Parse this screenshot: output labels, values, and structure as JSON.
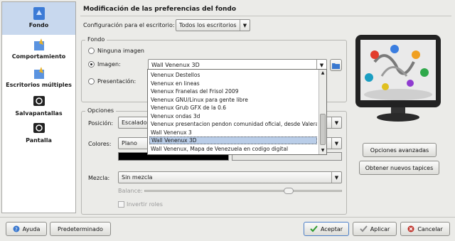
{
  "sidebar": {
    "items": [
      {
        "label": "Fondo",
        "icon": "background-icon",
        "active": true
      },
      {
        "label": "Comportamiento",
        "icon": "behavior-icon",
        "active": false
      },
      {
        "label": "Escritorios múltiples",
        "icon": "multiple-desktops-icon",
        "active": false
      },
      {
        "label": "Salvapantallas",
        "icon": "screensaver-icon",
        "active": false
      },
      {
        "label": "Pantalla",
        "icon": "display-icon",
        "active": false
      }
    ]
  },
  "header": {
    "title": "Modificación de las preferencias del fondo"
  },
  "config": {
    "label": "Configuración para el escritorio:",
    "value": "Todos los escritorios"
  },
  "fondo": {
    "group_title": "Fondo",
    "radio_none": "Ninguna imagen",
    "radio_image": "Imagen:",
    "radio_presentation": "Presentación:",
    "image_value": "Wall Venenux 3D"
  },
  "dropdown": {
    "items": [
      "Venenux Destellos",
      "Venenux en lineas",
      "Venenux Franelas del Frisol 2009",
      "Venenux GNU/Linux para gente libre",
      "Venenux Grub GFX de la 0.6",
      "Venenux ondas 3d",
      "Venenux presentacion pendon comunidad oficial, desde Valera",
      "Wall Venenux 3",
      "Wall Venenux 3D",
      "Wall Venenux, Mapa de Venezuela en codigo digital"
    ],
    "selected_index": 8
  },
  "opciones": {
    "group_title": "Opciones",
    "position_label": "Posición:",
    "position_value": "Escalado",
    "colors_label": "Colores:",
    "colors_value": "Plano",
    "mezcla_label": "Mezcla:",
    "mezcla_value": "Sin mezcla",
    "balance_label": "Balance:",
    "balance_level": 0.85,
    "invert_label": "Invertir roles"
  },
  "right_buttons": {
    "advanced": "Opciones avanzadas",
    "new_wallpapers": "Obtener nuevos tapices"
  },
  "footer": {
    "help": "Ayuda",
    "default": "Predeterminado",
    "accept": "Aceptar",
    "apply": "Aplicar",
    "cancel": "Cancelar"
  },
  "colors": {
    "selection": "#b9cde8",
    "accent_blue": "#2f6fc4",
    "accept_green": "#2e9a2e",
    "cancel_red": "#c0332b"
  }
}
